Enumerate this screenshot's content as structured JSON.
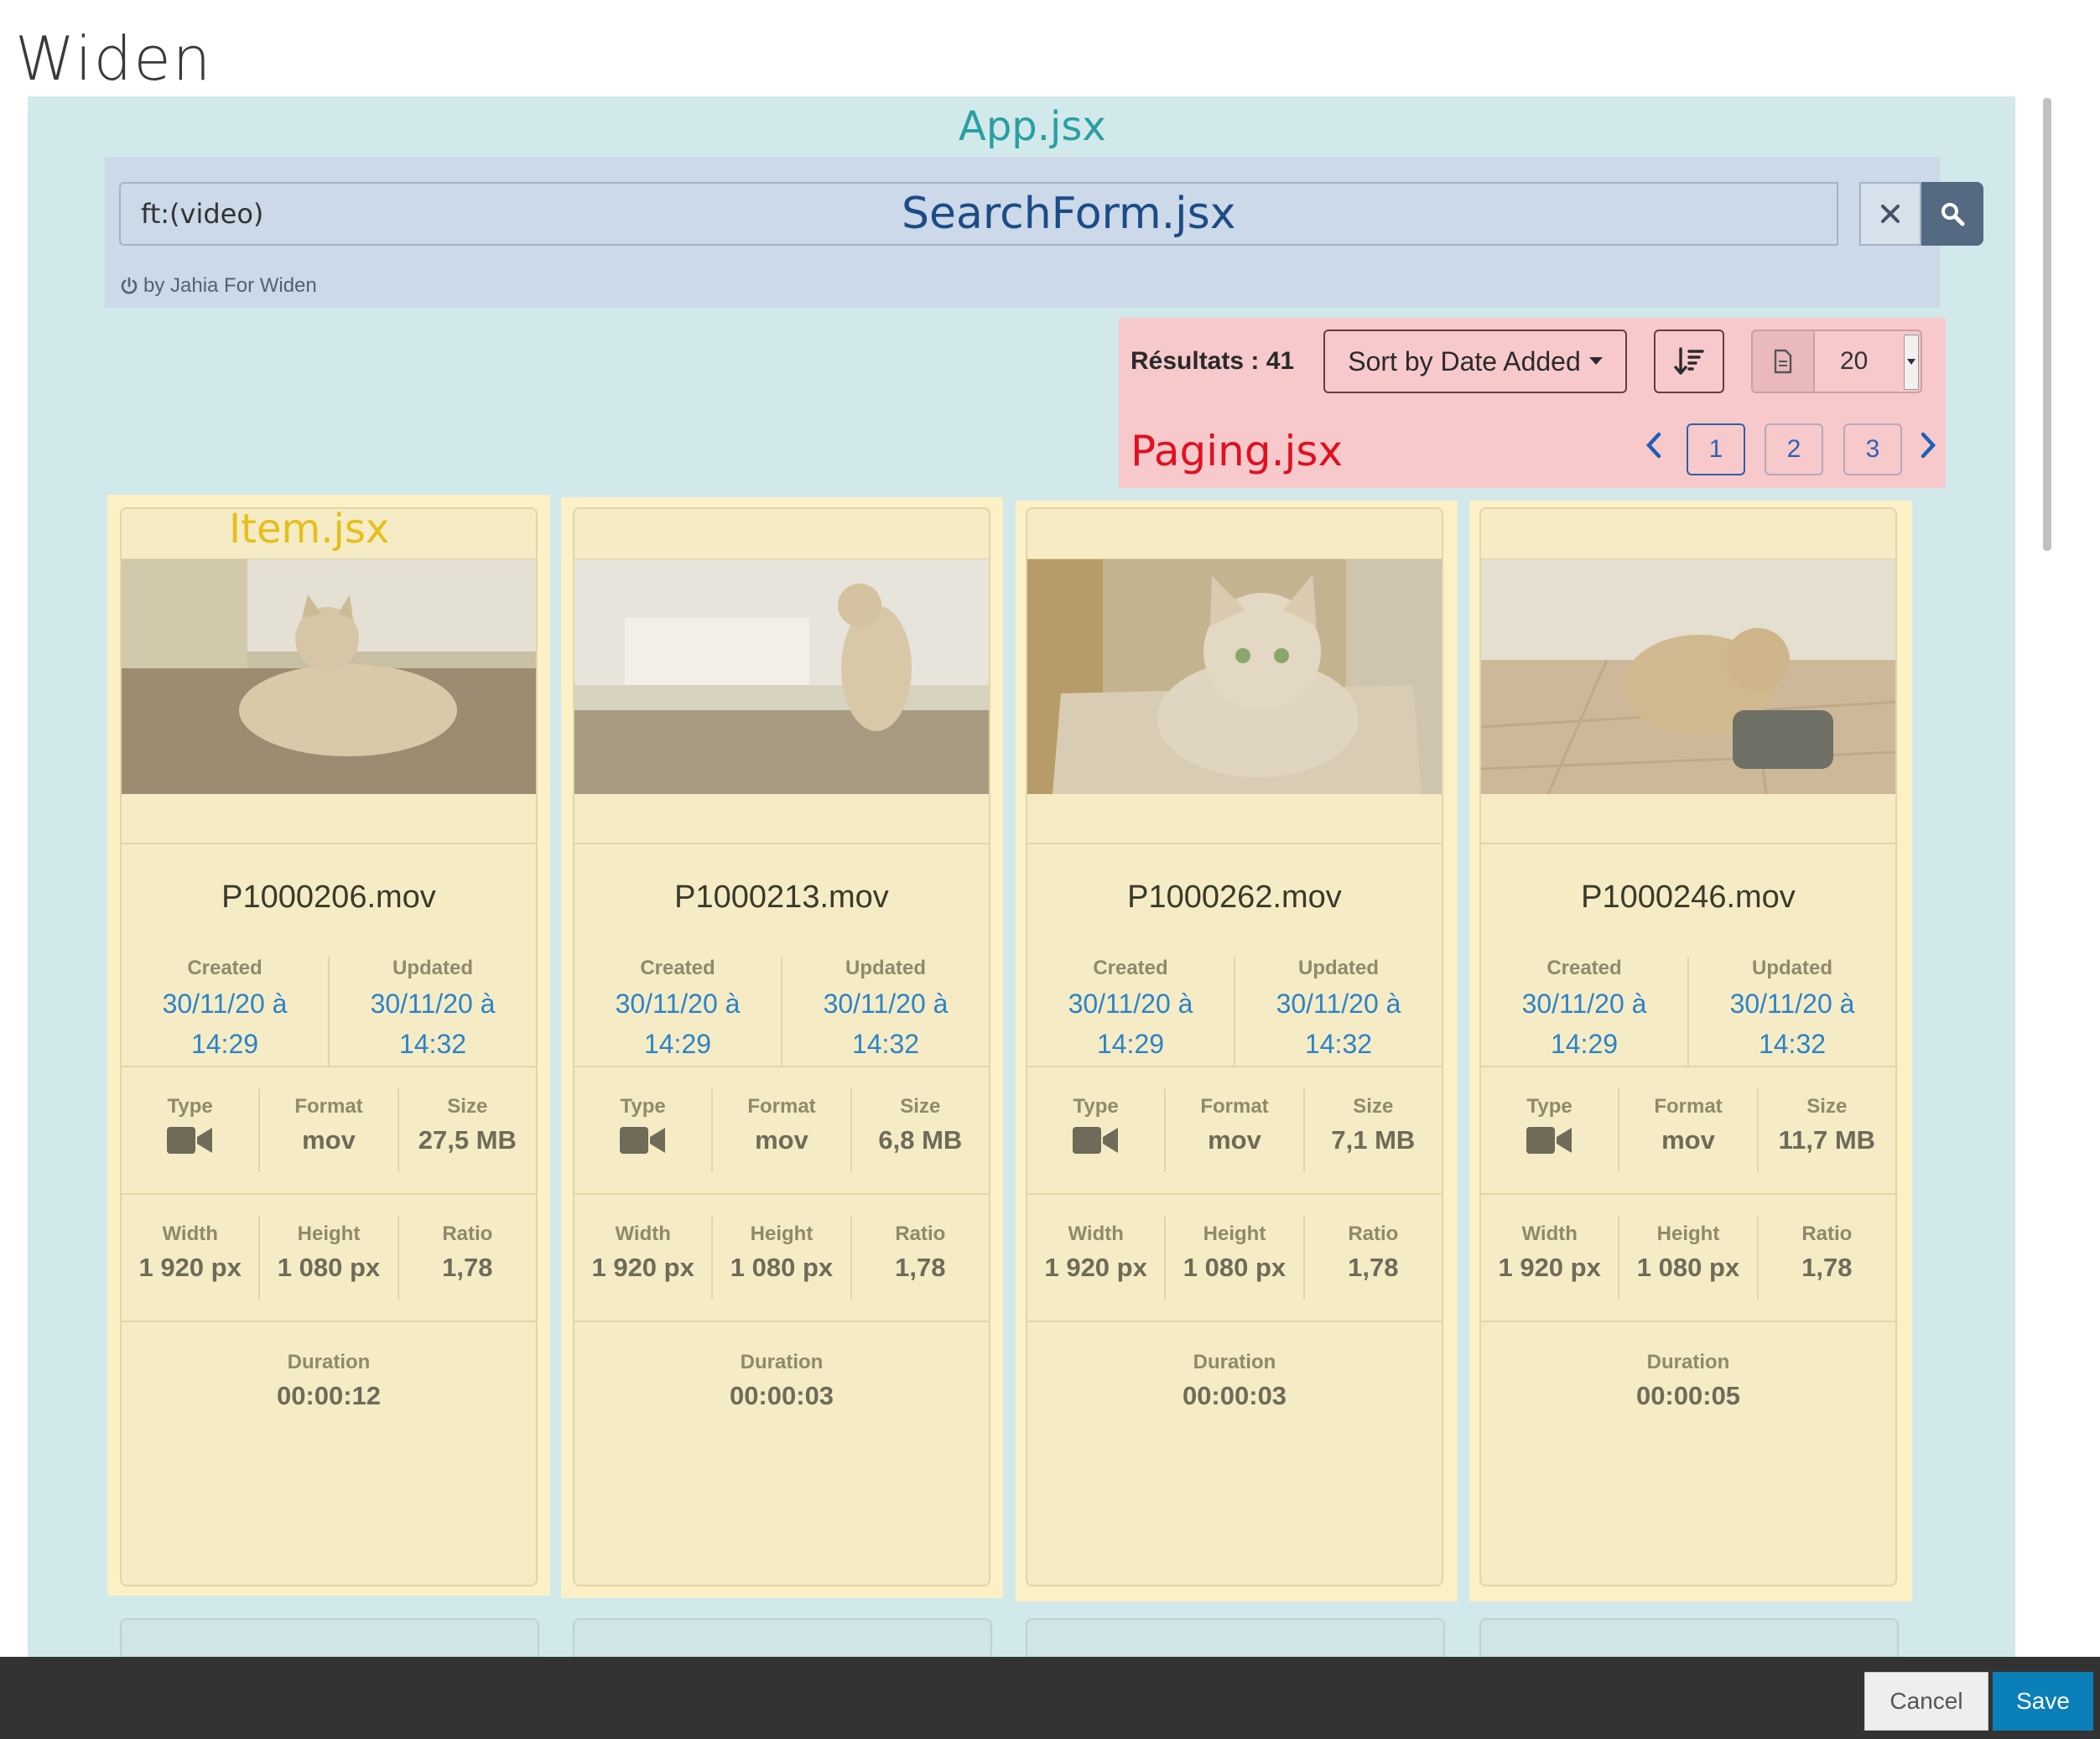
{
  "page": {
    "title": "Widen"
  },
  "app": {
    "label": "App.jsx"
  },
  "search": {
    "value": "ft:(video)",
    "zone_label": "SearchForm.jsx",
    "clear_icon": "close-icon",
    "search_icon": "search-icon",
    "powered_by": "by Jahia For Widen"
  },
  "paging": {
    "results_label": "Résultats : 41",
    "sort_label": "Sort by Date Added",
    "per_page": "20",
    "zone_label": "Paging.jsx",
    "pages": [
      "1",
      "2",
      "3"
    ],
    "current_page": "1"
  },
  "item": {
    "zone_label": "Item.jsx"
  },
  "labels": {
    "created": "Created",
    "updated": "Updated",
    "type": "Type",
    "format": "Format",
    "size": "Size",
    "width": "Width",
    "height": "Height",
    "ratio": "Ratio",
    "duration": "Duration"
  },
  "items": [
    {
      "name": "P1000206.mov",
      "created": "30/11/20 à 14:29",
      "updated": "30/11/20 à 14:32",
      "type_icon": "video-camera-icon",
      "format": "mov",
      "size": "27,5 MB",
      "width": "1 920 px",
      "height": "1 080 px",
      "ratio": "1,78",
      "duration": "00:00:12"
    },
    {
      "name": "P1000213.mov",
      "created": "30/11/20 à 14:29",
      "updated": "30/11/20 à 14:32",
      "type_icon": "video-camera-icon",
      "format": "mov",
      "size": "6,8 MB",
      "width": "1 920 px",
      "height": "1 080 px",
      "ratio": "1,78",
      "duration": "00:00:03"
    },
    {
      "name": "P1000262.mov",
      "created": "30/11/20 à 14:29",
      "updated": "30/11/20 à 14:32",
      "type_icon": "video-camera-icon",
      "format": "mov",
      "size": "7,1 MB",
      "width": "1 920 px",
      "height": "1 080 px",
      "ratio": "1,78",
      "duration": "00:00:03"
    },
    {
      "name": "P1000246.mov",
      "created": "30/11/20 à 14:29",
      "updated": "30/11/20 à 14:32",
      "type_icon": "video-camera-icon",
      "format": "mov",
      "size": "11,7 MB",
      "width": "1 920 px",
      "height": "1 080 px",
      "ratio": "1,78",
      "duration": "00:00:05"
    }
  ],
  "footer": {
    "cancel": "Cancel",
    "save": "Save"
  },
  "colors": {
    "app_zone": "#d1e9ea",
    "search_zone": "#cbd9e8",
    "paging_zone": "#f7c9cb",
    "item_zone": "#fbf0c6",
    "link": "#2c83c9",
    "save": "#0b7fb7"
  }
}
